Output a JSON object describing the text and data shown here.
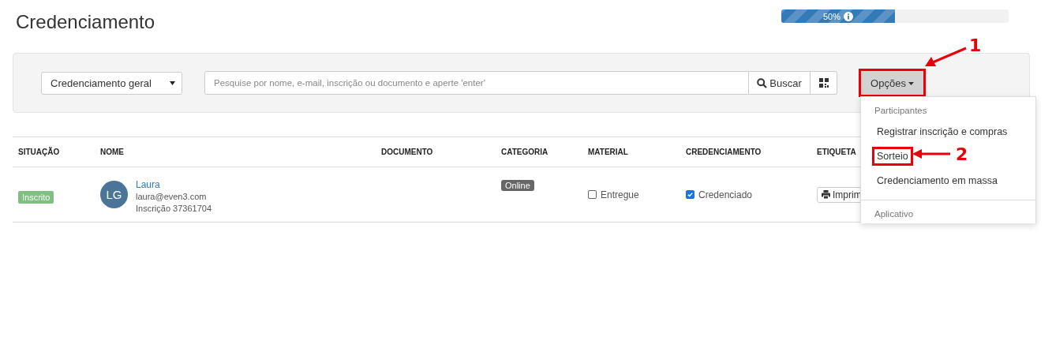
{
  "title": "Credenciamento",
  "progress": {
    "level": 0.5,
    "label": "50%"
  },
  "toolbar": {
    "select": "Credenciamento geral",
    "search": {
      "placeholder": "Pesquise por nome, e-mail, inscrição ou documento e aperte 'enter'"
    },
    "search_button": "Buscar",
    "options_button": "Opções"
  },
  "table": {
    "columns": [
      "SITUAÇÃO",
      "NOME",
      "DOCUMENTO",
      "CATEGORIA",
      "MATERIAL",
      "CREDENCIAMENTO",
      "ETIQUETA"
    ],
    "rows": [
      {
        "status": "Inscrito",
        "initials": "LG",
        "name": "Laura",
        "email": "laura@even3.com",
        "registration": "Inscrição 37361704",
        "category": "Online",
        "material": {
          "label": "Entregue",
          "checked": false
        },
        "accreditation": {
          "label": "Credenciado",
          "checked": true
        },
        "label_button": "Imprim"
      }
    ]
  },
  "menu": {
    "items": [
      {
        "kind": "header",
        "text": "Participantes"
      },
      {
        "kind": "item",
        "text": "Registrar inscrição e compras",
        "highlighted": false
      },
      {
        "kind": "item",
        "text": "Sorteio",
        "highlighted": true
      },
      {
        "kind": "item",
        "text": "Credenciamento em massa",
        "highlighted": false
      },
      {
        "kind": "divider"
      },
      {
        "kind": "header",
        "text": "Aplicativo"
      }
    ]
  },
  "annotations": [
    "1",
    "2"
  ]
}
